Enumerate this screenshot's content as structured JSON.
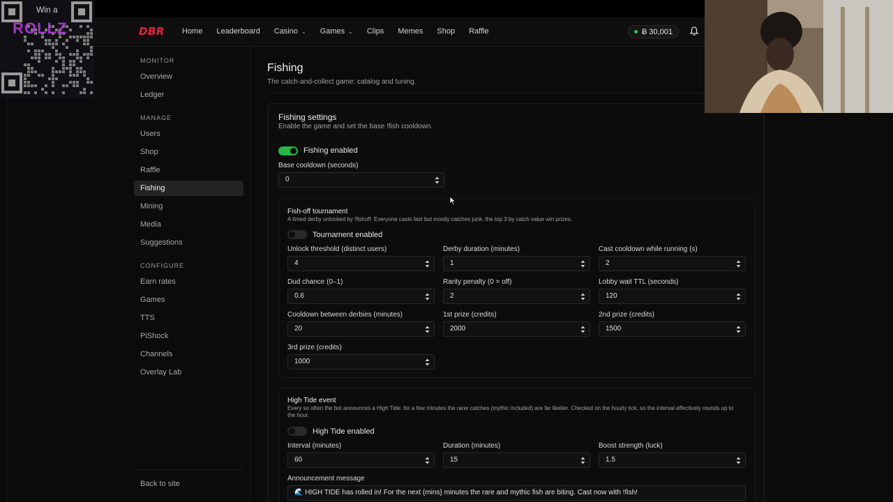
{
  "overlay": {
    "qr_title": "Win a",
    "qr_brand": "ROLLZ"
  },
  "nav": {
    "logo": "DBR",
    "links": [
      {
        "label": "Home",
        "dropdown": false
      },
      {
        "label": "Leaderboard",
        "dropdown": false
      },
      {
        "label": "Casino",
        "dropdown": true
      },
      {
        "label": "Games",
        "dropdown": true
      },
      {
        "label": "Clips",
        "dropdown": false
      },
      {
        "label": "Memes",
        "dropdown": false
      },
      {
        "label": "Shop",
        "dropdown": false
      },
      {
        "label": "Raffle",
        "dropdown": false
      }
    ],
    "balance": "Ƀ 30,001",
    "status_color": "#28c840"
  },
  "sidebar": {
    "sections": [
      {
        "title": "MONITOR",
        "items": [
          "Overview",
          "Ledger"
        ]
      },
      {
        "title": "MANAGE",
        "items": [
          "Users",
          "Shop",
          "Raffle",
          "Fishing",
          "Mining",
          "Media",
          "Suggestions"
        ]
      },
      {
        "title": "CONFIGURE",
        "items": [
          "Earn rates",
          "Games",
          "TTS",
          "PiShock",
          "Channels",
          "Overlay Lab"
        ]
      }
    ],
    "active": "Fishing",
    "back": "Back to site"
  },
  "page": {
    "title": "Fishing",
    "subtitle": "The catch-and-collect game: catalog and tuning."
  },
  "settings": {
    "title": "Fishing settings",
    "subtitle": "Enable the game and set the base !fish cooldown.",
    "enabled_label": "Fishing enabled",
    "enabled": true,
    "cooldown_label": "Base cooldown (seconds)",
    "cooldown_value": "0"
  },
  "tournament": {
    "title": "Fish-off tournament",
    "desc": "A timed derby unlocked by !fishoff. Everyone casts fast but mostly catches junk; the top 3 by catch value win prizes.",
    "enabled_label": "Tournament enabled",
    "enabled": false,
    "fields": [
      {
        "label": "Unlock threshold (distinct users)",
        "value": "4"
      },
      {
        "label": "Derby duration (minutes)",
        "value": "1"
      },
      {
        "label": "Cast cooldown while running (s)",
        "value": "2"
      },
      {
        "label": "Dud chance (0–1)",
        "value": "0.6"
      },
      {
        "label": "Rarity penalty (0 = off)",
        "value": "2"
      },
      {
        "label": "Lobby wait TTL (seconds)",
        "value": "120"
      },
      {
        "label": "Cooldown between derbies (minutes)",
        "value": "20"
      },
      {
        "label": "1st prize (credits)",
        "value": "2000"
      },
      {
        "label": "2nd prize (credits)",
        "value": "1500"
      },
      {
        "label": "3rd prize (credits)",
        "value": "1000"
      }
    ]
  },
  "hightide": {
    "title": "High Tide event",
    "desc": "Every so often the bot announces a High Tide: for a few minutes the rarer catches (mythic included) are far likelier. Checked on the hourly tick, so the interval effectively rounds up to the hour.",
    "enabled_label": "High Tide enabled",
    "enabled": false,
    "fields": [
      {
        "label": "Interval (minutes)",
        "value": "60"
      },
      {
        "label": "Duration (minutes)",
        "value": "15"
      },
      {
        "label": "Boost strength (luck)",
        "value": "1.5"
      }
    ],
    "message_label": "Announcement message",
    "message_value": "🌊 HIGH TIDE has rolled in! For the next {mins} minutes the rare and mythic fish are biting. Cast now with !fish!"
  }
}
